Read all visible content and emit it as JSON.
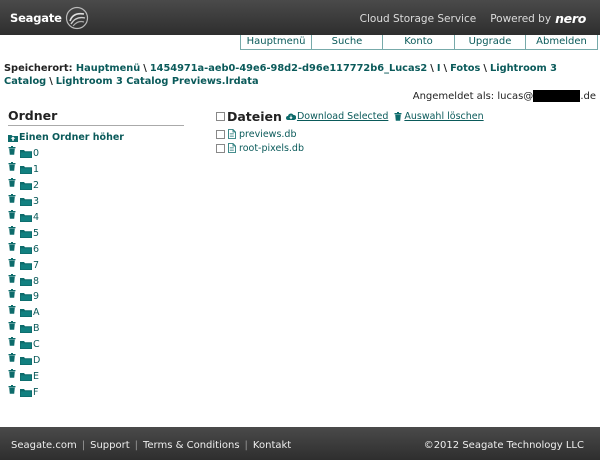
{
  "header": {
    "logo": "Seagate",
    "service": "Cloud Storage Service",
    "powered_by": "Powered by",
    "brand": "nero"
  },
  "nav": [
    "Hauptmenü",
    "Suche",
    "Konto",
    "Upgrade",
    "Abmelden"
  ],
  "breadcrumb": {
    "label": "Speicherort:",
    "items": [
      "Hauptmenü",
      "1454971a-aeb0-49e6-98d2-d96e117772b6_Lucas2",
      "I",
      "Fotos",
      "Lightroom 3 Catalog",
      "Lightroom 3 Catalog Previews.lrdata"
    ]
  },
  "login": {
    "label": "Angemeldet als:",
    "user_prefix": "lucas@",
    "user_suffix": ".de"
  },
  "sidebar": {
    "title": "Ordner",
    "up_label": "Einen Ordner höher",
    "folders": [
      "0",
      "1",
      "2",
      "3",
      "4",
      "5",
      "6",
      "7",
      "8",
      "9",
      "A",
      "B",
      "C",
      "D",
      "E",
      "F"
    ]
  },
  "files": {
    "title": "Dateien",
    "download_label": "Download Selected",
    "delete_label": "Auswahl löschen",
    "items": [
      "previews.db",
      "root-pixels.db"
    ]
  },
  "footer": {
    "links": [
      "Seagate.com",
      "Support",
      "Terms & Conditions",
      "Kontakt"
    ],
    "copyright": "©2012 Seagate Technology LLC"
  },
  "colors": {
    "link": "#0a5a5a",
    "header_bg": "#3a3a3a",
    "nav_border": "#77aaaa"
  }
}
